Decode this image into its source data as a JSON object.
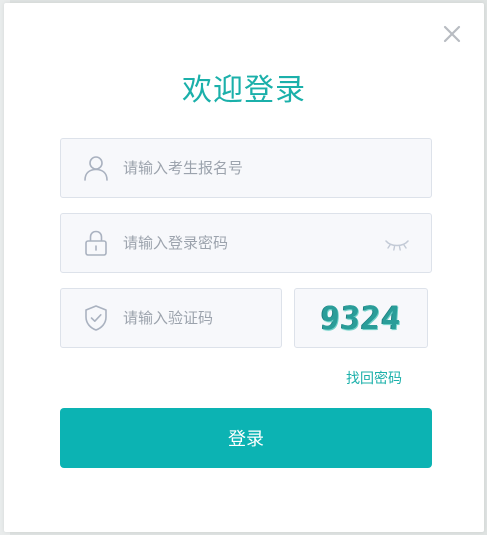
{
  "colors": {
    "accent": "#1bb0aa",
    "button": "#0cb3b3",
    "field_bg": "#f7f8fb",
    "field_border": "#dde2ea",
    "icon": "#aab2c0"
  },
  "dialog": {
    "title": "欢迎登录",
    "close_icon": "close-icon"
  },
  "form": {
    "username": {
      "icon": "user-icon",
      "value": "",
      "placeholder": "请输入考生报名号"
    },
    "password": {
      "icon": "lock-icon",
      "value": "",
      "placeholder": "请输入登录密码",
      "toggle_icon": "eye-closed-icon"
    },
    "captcha": {
      "icon": "shield-check-icon",
      "value": "",
      "placeholder": "请输入验证码",
      "image_text": "9324"
    },
    "forgot_label": "找回密码",
    "submit_label": "登录"
  }
}
